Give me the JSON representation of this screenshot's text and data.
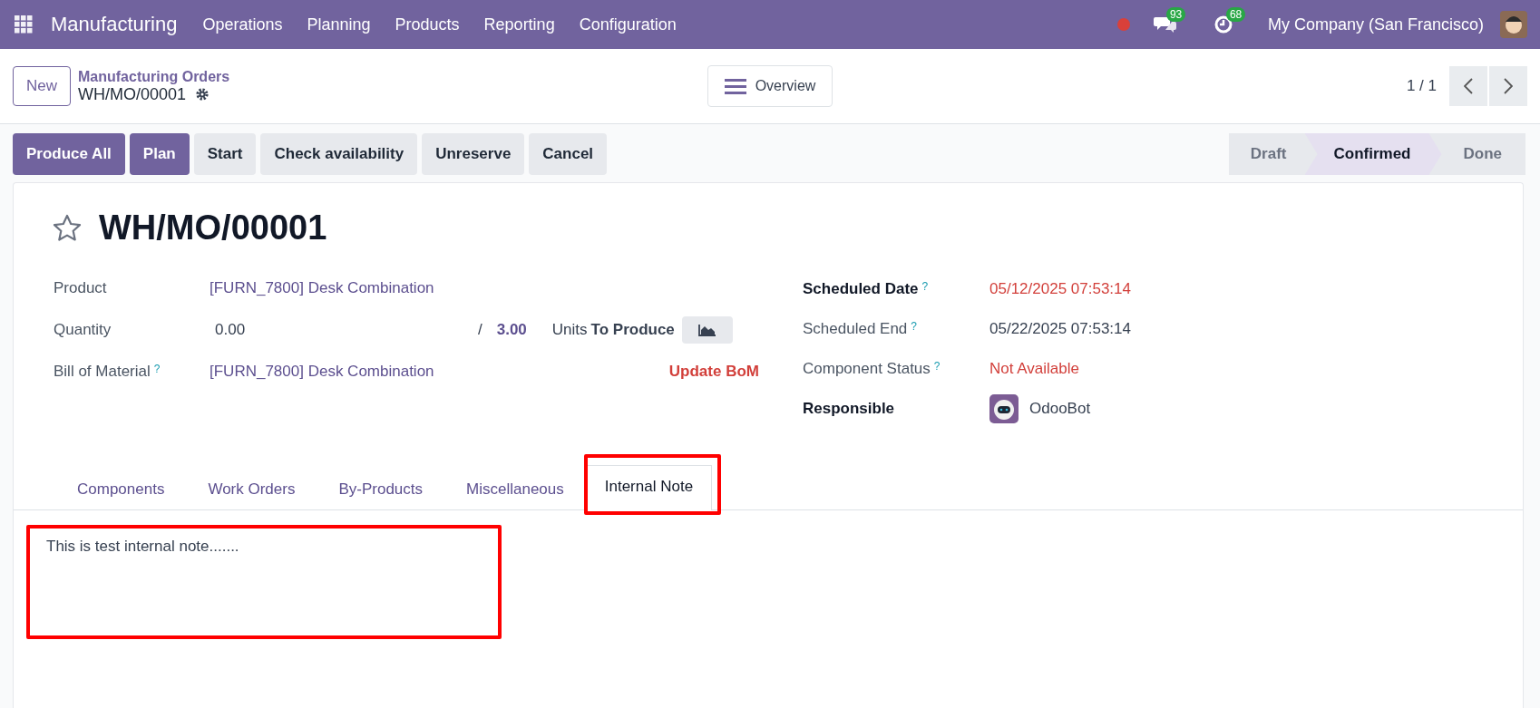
{
  "navbar": {
    "app_name": "Manufacturing",
    "menus": [
      "Operations",
      "Planning",
      "Products",
      "Reporting",
      "Configuration"
    ],
    "messages_count": "93",
    "activities_count": "68",
    "company": "My Company (San Francisco)"
  },
  "control_panel": {
    "new_button": "New",
    "breadcrumb": "Manufacturing Orders",
    "record_name": "WH/MO/00001",
    "view_button": "Overview",
    "pager": "1 / 1"
  },
  "actions": [
    {
      "label": "Produce All",
      "primary": true
    },
    {
      "label": "Plan",
      "primary": true
    },
    {
      "label": "Start",
      "primary": false
    },
    {
      "label": "Check availability",
      "primary": false
    },
    {
      "label": "Unreserve",
      "primary": false
    },
    {
      "label": "Cancel",
      "primary": false
    }
  ],
  "statusbar": [
    {
      "label": "Draft",
      "selected": false
    },
    {
      "label": "Confirmed",
      "selected": true
    },
    {
      "label": "Done",
      "selected": false
    }
  ],
  "form": {
    "title": "WH/MO/00001",
    "starred": false,
    "left_fields": [
      {
        "kind": "text",
        "label": "Product",
        "value": "[FURN_7800] Desk Combination",
        "linked": true,
        "warning": false,
        "required": false
      },
      {
        "kind": "quantity",
        "label": "Quantity",
        "value": "0.00",
        "separator": "/",
        "target": "3.00",
        "unit": "Units",
        "suffix": "To Produce",
        "required": false
      },
      {
        "kind": "text",
        "label": "Bill of Material",
        "help": "?",
        "value": "[FURN_7800] Desk Combination",
        "linked": true,
        "warning": false,
        "action": "Update BoM",
        "required": false
      }
    ],
    "right_fields": [
      {
        "kind": "text",
        "label": "Scheduled Date",
        "help": "?",
        "value": "05/12/2025 07:53:14",
        "linked": false,
        "warning": true,
        "required": true
      },
      {
        "kind": "text",
        "label": "Scheduled End",
        "help": "?",
        "value": "05/22/2025 07:53:14",
        "linked": false,
        "warning": false,
        "required": false
      },
      {
        "kind": "text",
        "label": "Component Status",
        "help": "?",
        "value": "Not Available",
        "linked": false,
        "warning": true,
        "required": false
      },
      {
        "kind": "user",
        "label": "Responsible",
        "value": "OdooBot",
        "required": true
      }
    ]
  },
  "tabs": [
    {
      "label": "Components",
      "selected": false,
      "highlighted": false
    },
    {
      "label": "Work Orders",
      "selected": false,
      "highlighted": false
    },
    {
      "label": "By-Products",
      "selected": false,
      "highlighted": false
    },
    {
      "label": "Miscellaneous",
      "selected": false,
      "highlighted": false
    },
    {
      "label": "Internal Note",
      "selected": true,
      "highlighted": true
    }
  ],
  "note": {
    "text": "This is test internal note.......",
    "highlighted": true
  }
}
